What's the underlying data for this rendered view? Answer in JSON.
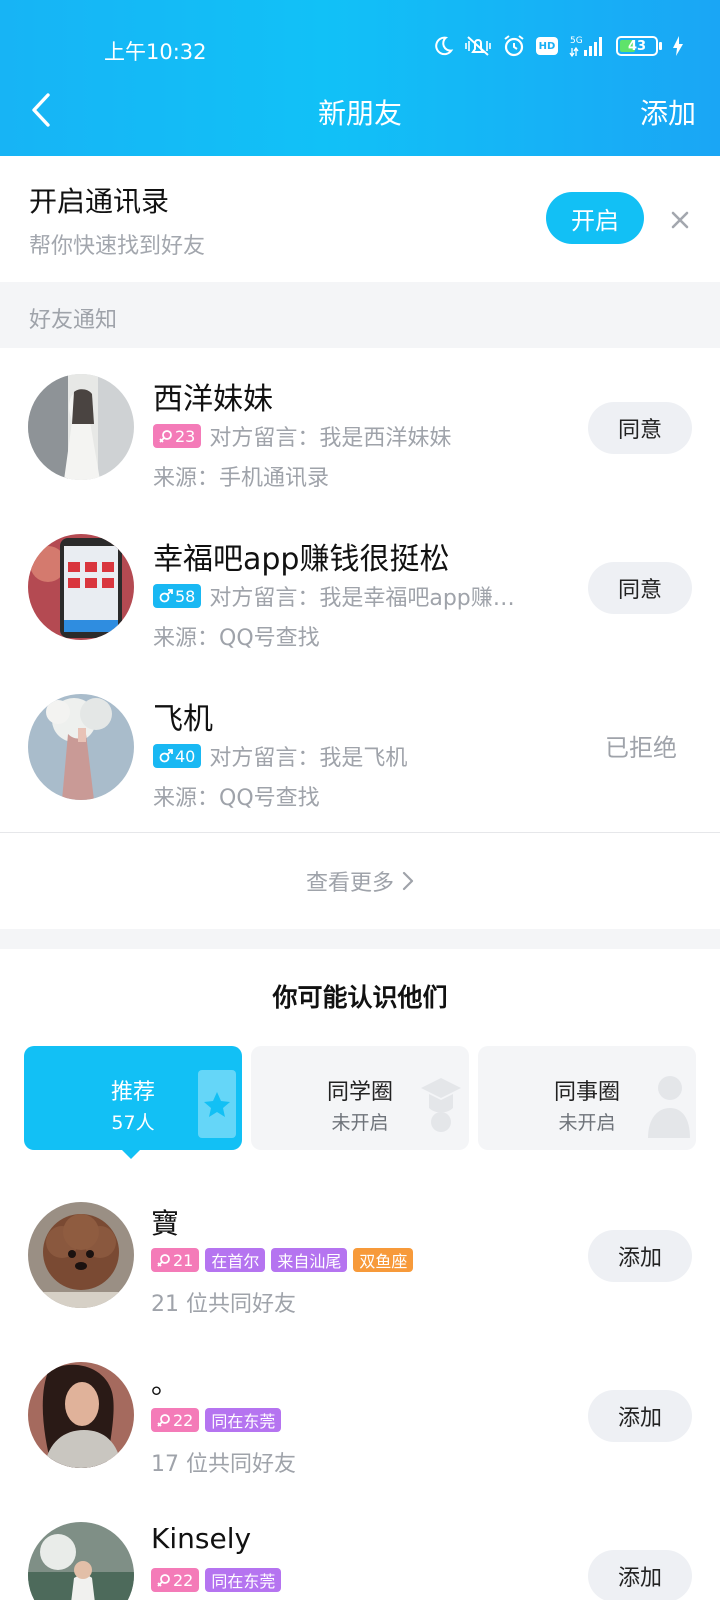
{
  "status": {
    "time": "上午10:32",
    "network": "5G",
    "hd": "HD",
    "battery": "43"
  },
  "header": {
    "title": "新朋友",
    "add_label": "添加"
  },
  "contacts_banner": {
    "title": "开启通讯录",
    "subtitle": "帮你快速找到好友",
    "enable_label": "开启"
  },
  "notifications": {
    "section_label": "好友通知",
    "items": [
      {
        "name": "西洋妹妹",
        "gender": "female",
        "age": "23",
        "message": "对方留言：我是西洋妹妹",
        "source": "来源：手机通讯录",
        "action": "同意"
      },
      {
        "name": "幸福吧app赚钱很挺松",
        "gender": "male",
        "age": "58",
        "message": "对方留言：我是幸福吧app赚…",
        "source": "来源：QQ号查找",
        "action": "同意"
      },
      {
        "name": "飞机",
        "gender": "male",
        "age": "40",
        "message": "对方留言：我是飞机",
        "source": "来源：QQ号查找",
        "status": "已拒绝"
      }
    ],
    "see_more": "查看更多"
  },
  "suggestions": {
    "title": "你可能认识他们",
    "tabs": [
      {
        "label": "推荐",
        "sub": "57人",
        "active": true
      },
      {
        "label": "同学圈",
        "sub": "未开启",
        "active": false
      },
      {
        "label": "同事圈",
        "sub": "未开启",
        "active": false
      }
    ],
    "items": [
      {
        "name": "寶",
        "age": "21",
        "tags": [
          "在首尔",
          "来自汕尾",
          "双鱼座"
        ],
        "mutual": "21 位共同好友",
        "action": "添加"
      },
      {
        "name": "。",
        "age": "22",
        "tags": [
          "同在东莞"
        ],
        "mutual": "17 位共同好友",
        "action": "添加"
      },
      {
        "name": "Kinsely",
        "age": "22",
        "tags": [
          "同在东莞"
        ],
        "mutual": "",
        "action": "添加"
      }
    ]
  },
  "colors": {
    "accent": "#12c0f5",
    "female_tag": "#f47bb8",
    "male_tag": "#19b8f3",
    "location_tag": "#b574f0",
    "zodiac_tag": "#f79a3a"
  }
}
